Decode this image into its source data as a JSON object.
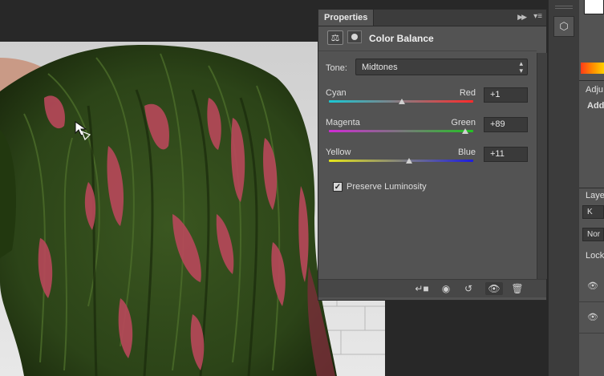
{
  "colors": {
    "panel_bg": "#535353",
    "workspace_bg": "#282828",
    "hair_dark": "#2b3f17",
    "hair_pink": "#b8485a"
  },
  "properties_panel": {
    "tab_label": "Properties",
    "collapse_icon": "double-chevron-right-icon",
    "menu_icon": "panel-menu-icon",
    "header": {
      "adjustment_icon": "balance-scale-icon",
      "mask_icon": "layer-mask-icon",
      "title": "Color Balance"
    },
    "tone": {
      "label": "Tone:",
      "value": "Midtones",
      "icon": "updown-arrows-icon"
    },
    "sliders": [
      {
        "left_label": "Cyan",
        "right_label": "Red",
        "value": "+1",
        "position_value": 1,
        "range": [
          -100,
          100
        ]
      },
      {
        "left_label": "Magenta",
        "right_label": "Green",
        "value": "+89",
        "position_value": 89,
        "range": [
          -100,
          100
        ]
      },
      {
        "left_label": "Yellow",
        "right_label": "Blue",
        "value": "+11",
        "position_value": 11,
        "range": [
          -100,
          100
        ]
      }
    ],
    "preserve_luminosity": {
      "label": "Preserve Luminosity",
      "checked": true
    },
    "footer_icons": [
      "clip-to-layer-icon",
      "view-previous-state-icon",
      "reset-icon",
      "visibility-eye-icon",
      "trash-icon"
    ]
  },
  "right_panels": {
    "adjustments_label": "Adju",
    "add_label": "Add",
    "layers_label": "Laye",
    "filter_text": "K",
    "blend_mode": "Nor",
    "lock_label": "Lock"
  }
}
